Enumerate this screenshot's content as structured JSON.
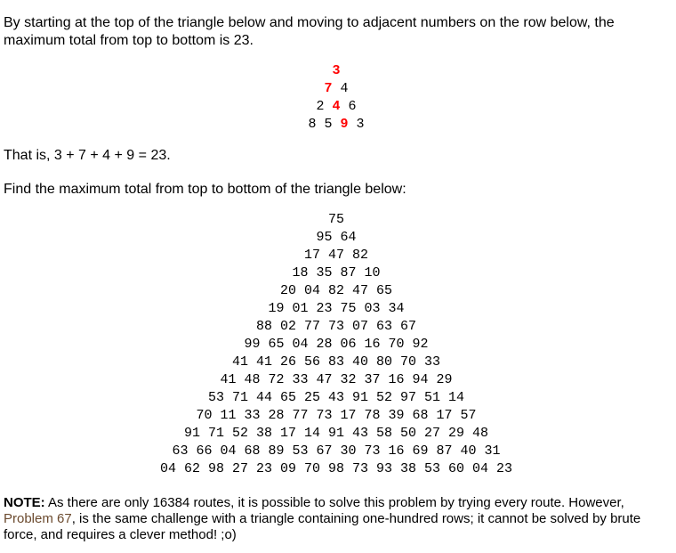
{
  "intro": "By starting at the top of the triangle below and moving to adjacent numbers on the row below, the maximum total from top to bottom is 23.",
  "example_triangle": [
    [
      {
        "t": "3",
        "h": true
      }
    ],
    [
      {
        "t": "7",
        "h": true
      },
      {
        "t": "4",
        "h": false
      }
    ],
    [
      {
        "t": "2",
        "h": false
      },
      {
        "t": "4",
        "h": true
      },
      {
        "t": "6",
        "h": false
      }
    ],
    [
      {
        "t": "8",
        "h": false
      },
      {
        "t": "5",
        "h": false
      },
      {
        "t": "9",
        "h": true
      },
      {
        "t": "3",
        "h": false
      }
    ]
  ],
  "that_is": "That is, 3 + 7 + 4 + 9 = 23.",
  "find_prompt": "Find the maximum total from top to bottom of the triangle below:",
  "triangle_rows": [
    "75",
    "95 64",
    "17 47 82",
    "18 35 87 10",
    "20 04 82 47 65",
    "19 01 23 75 03 34",
    "88 02 77 73 07 63 67",
    "99 65 04 28 06 16 70 92",
    "41 41 26 56 83 40 80 70 33",
    "41 48 72 33 47 32 37 16 94 29",
    "53 71 44 65 25 43 91 52 97 51 14",
    "70 11 33 28 77 73 17 78 39 68 17 57",
    "91 71 52 38 17 14 91 43 58 50 27 29 48",
    "63 66 04 68 89 53 67 30 73 16 69 87 40 31",
    "04 62 98 27 23 09 70 98 73 93 38 53 60 04 23"
  ],
  "note": {
    "label": "NOTE:",
    "text_before": " As there are only 16384 routes, it is possible to solve this problem by trying every route. However, ",
    "link_text": "Problem 67",
    "text_after": ", is the same challenge with a triangle containing one-hundred rows; it cannot be solved by brute force, and requires a clever method! ;o)"
  },
  "colors": {
    "highlight": "#ff0000",
    "link": "#6b4a2e"
  }
}
